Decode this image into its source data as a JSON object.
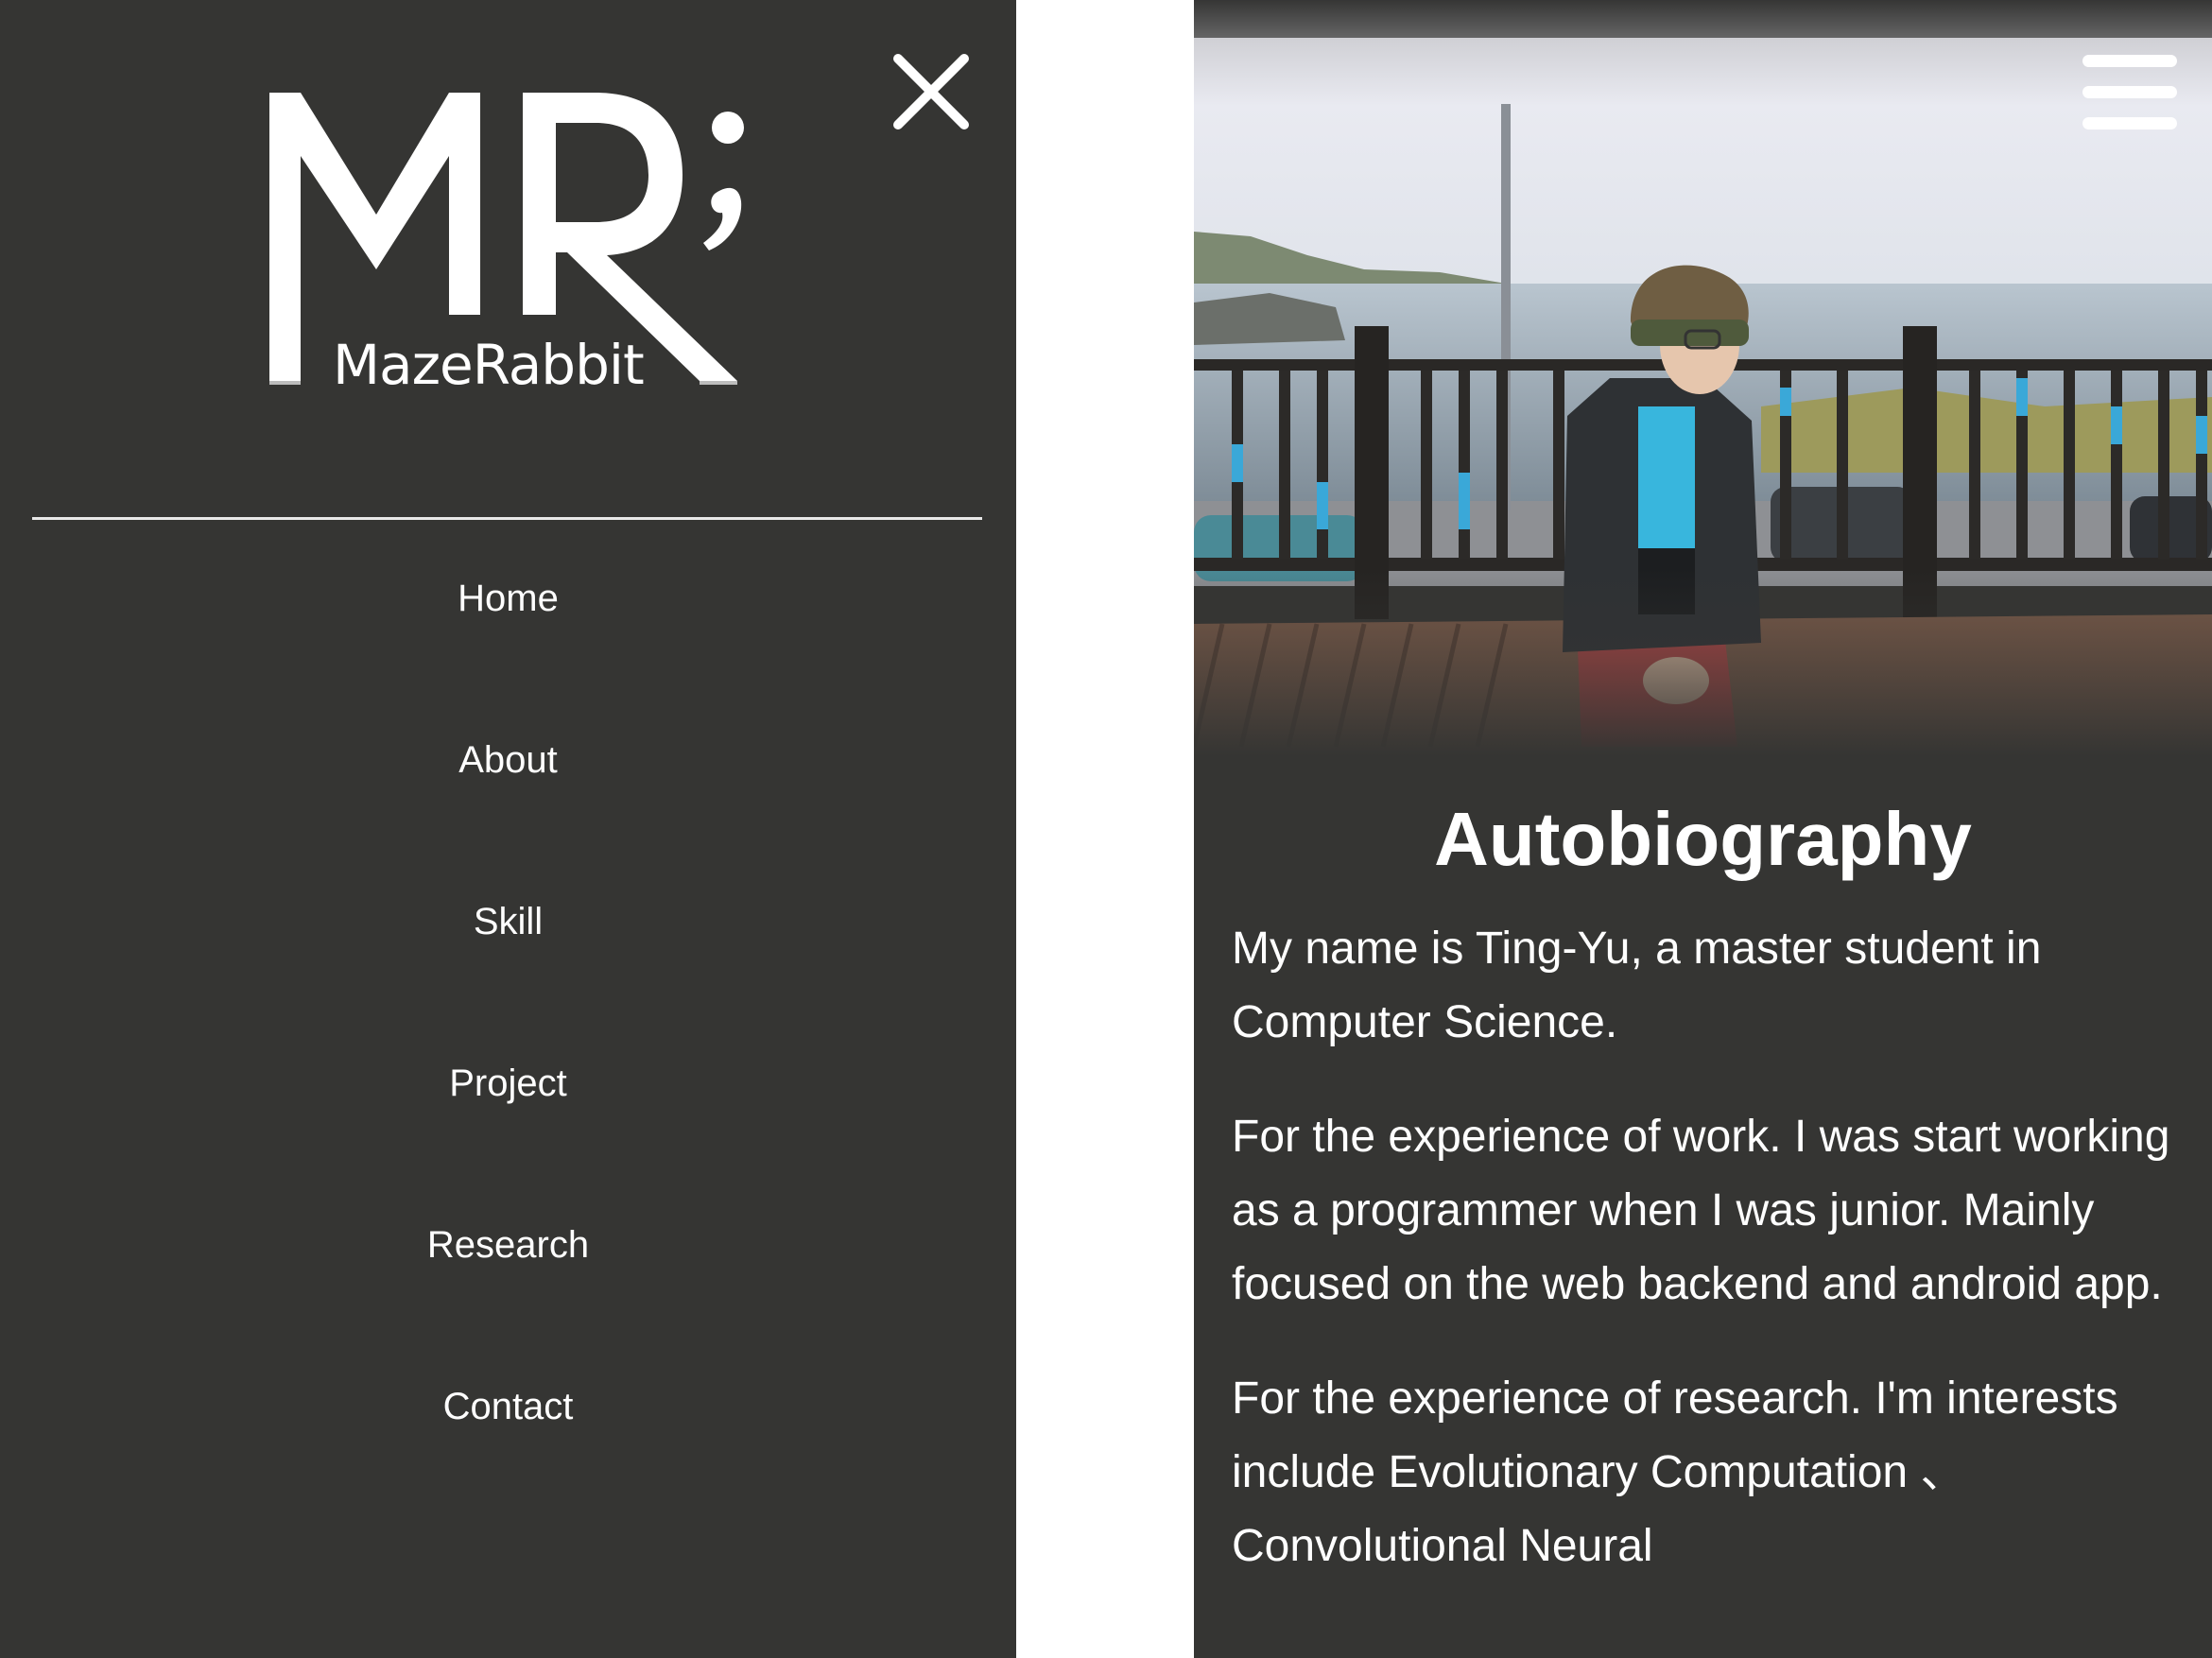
{
  "drawer": {
    "logo_text": "MazeRabbit",
    "logo_monogram": "MR;",
    "close_icon": "close-icon",
    "nav_items": [
      {
        "label": "Home"
      },
      {
        "label": "About"
      },
      {
        "label": "Skill"
      },
      {
        "label": "Project"
      },
      {
        "label": "Research"
      },
      {
        "label": "Contact"
      }
    ]
  },
  "page": {
    "menu_icon": "hamburger-menu-icon",
    "hero_image": "photo of a person wearing a beanie sitting on a seaside boardwalk bench",
    "title": "Autobiography",
    "paragraphs": [
      "My name is Ting-Yu, a master student in Computer Science.",
      "For the experience of work. I was start working as a programmer when I was junior. Mainly focused on the web backend and android app.",
      "For the experience of research. I'm interests include Evolutionary Computation 、Convolutional Neural"
    ]
  },
  "colors": {
    "panel_background": "#353533",
    "text": "#ffffff",
    "gap_background": "#ffffff"
  }
}
